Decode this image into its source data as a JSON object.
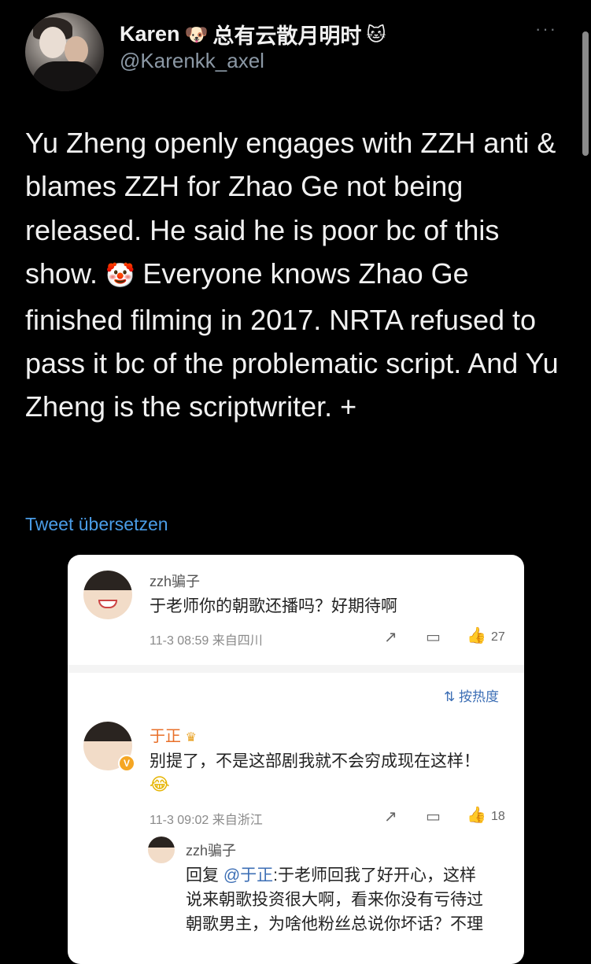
{
  "author": {
    "name": "Karen",
    "name_emoji_1": "🐶",
    "name_cn": "总有云散月明时",
    "name_emoji_2": "🐱",
    "handle": "@Karenkk_axel"
  },
  "more_label": "···",
  "tweet": {
    "text_before_emoji": "Yu Zheng openly engages with ZZH anti & blames ZZH for Zhao Ge not being released. He said he is poor bc of this show. ",
    "emoji": "🤡",
    "text_after_emoji": " Everyone knows Zhao Ge finished filming in 2017. NRTA refused to pass it bc of the problematic script. And Yu Zheng is the scriptwriter. +",
    "translate_label": "Tweet übersetzen"
  },
  "embedded_screenshot": {
    "comment1": {
      "username": "zzh骗子",
      "text": "于老师你的朝歌还播吗？好期待啊",
      "meta": "11-3 08:59 来自四川",
      "share_icon": "share-icon",
      "comment_icon": "comment-icon",
      "like_icon": "like-icon",
      "like_count": "27"
    },
    "sort_label": "按热度",
    "sort_icon": "sort-icon",
    "reply1": {
      "username": "于正",
      "crown": "♛",
      "verified_badge": "V",
      "text": "别提了，不是这部剧我就不会穷成现在这样！",
      "emoji": "😂",
      "meta": "11-3 09:02 来自浙江",
      "like_count": "18"
    },
    "reply2": {
      "username": "zzh骗子",
      "reply_prefix": "回复 ",
      "mention": "@于正",
      "line1_rest": ":于老师回我了好开心，这样",
      "line2": "说来朝歌投资很大啊，看来你没有亏待过",
      "line3": "朝歌男主，为啥他粉丝总说你坏话？不理"
    }
  }
}
